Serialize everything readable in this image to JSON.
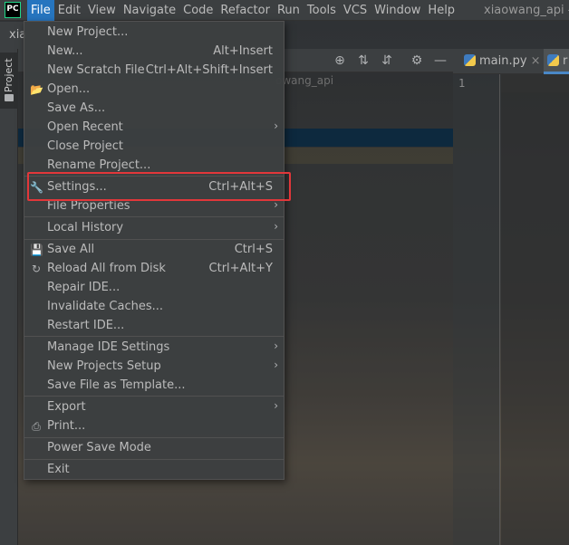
{
  "app": {
    "logo": "PC",
    "title_fragment": "xiaowang_api - ",
    "project_crumb": "xia",
    "project_path_fragment": "owang_api"
  },
  "menubar": {
    "items": [
      "File",
      "Edit",
      "View",
      "Navigate",
      "Code",
      "Refactor",
      "Run",
      "Tools",
      "VCS",
      "Window",
      "Help"
    ],
    "active": "File"
  },
  "left_stripe": {
    "project_tab": "Project"
  },
  "editor": {
    "tabs": [
      {
        "label": "main.py",
        "icon": "python-file-icon"
      },
      {
        "label": "r",
        "icon": "python-file-icon"
      }
    ],
    "line_numbers": [
      "1"
    ]
  },
  "file_menu": {
    "items": [
      {
        "label": "New Project...",
        "shortcut": "",
        "icon": "",
        "submenu": false
      },
      {
        "label": "New...",
        "shortcut": "Alt+Insert",
        "icon": "",
        "submenu": false
      },
      {
        "label": "New Scratch File",
        "shortcut": "Ctrl+Alt+Shift+Insert",
        "icon": "",
        "submenu": false
      },
      {
        "label": "Open...",
        "shortcut": "",
        "icon": "folder-icon",
        "submenu": false
      },
      {
        "label": "Save As...",
        "shortcut": "",
        "icon": "",
        "submenu": false
      },
      {
        "label": "Open Recent",
        "shortcut": "",
        "icon": "",
        "submenu": true
      },
      {
        "label": "Close Project",
        "shortcut": "",
        "icon": "",
        "submenu": false
      },
      {
        "label": "Rename Project...",
        "shortcut": "",
        "icon": "",
        "submenu": false
      },
      {
        "label": "Settings...",
        "shortcut": "Ctrl+Alt+S",
        "icon": "wrench-icon",
        "submenu": false,
        "highlighted": true
      },
      {
        "label": "File Properties",
        "shortcut": "",
        "icon": "",
        "submenu": true
      },
      {
        "label": "Local History",
        "shortcut": "",
        "icon": "",
        "submenu": true
      },
      {
        "label": "Save All",
        "shortcut": "Ctrl+S",
        "icon": "save-icon",
        "submenu": false
      },
      {
        "label": "Reload All from Disk",
        "shortcut": "Ctrl+Alt+Y",
        "icon": "reload-icon",
        "submenu": false
      },
      {
        "label": "Repair IDE...",
        "shortcut": "",
        "icon": "",
        "submenu": false
      },
      {
        "label": "Invalidate Caches...",
        "shortcut": "",
        "icon": "",
        "submenu": false
      },
      {
        "label": "Restart IDE...",
        "shortcut": "",
        "icon": "",
        "submenu": false
      },
      {
        "label": "Manage IDE Settings",
        "shortcut": "",
        "icon": "",
        "submenu": true
      },
      {
        "label": "New Projects Setup",
        "shortcut": "",
        "icon": "",
        "submenu": true
      },
      {
        "label": "Save File as Template...",
        "shortcut": "",
        "icon": "",
        "submenu": false
      },
      {
        "label": "Export",
        "shortcut": "",
        "icon": "",
        "submenu": true
      },
      {
        "label": "Print...",
        "shortcut": "",
        "icon": "print-icon",
        "submenu": false
      },
      {
        "label": "Power Save Mode",
        "shortcut": "",
        "icon": "",
        "submenu": false
      },
      {
        "label": "Exit",
        "shortcut": "",
        "icon": "",
        "submenu": false
      }
    ]
  },
  "colors": {
    "menubar_bg": "#3c3f41",
    "active_menu": "#2675bf",
    "highlight_box": "#e2373a",
    "selection_row": "#0d293e"
  }
}
